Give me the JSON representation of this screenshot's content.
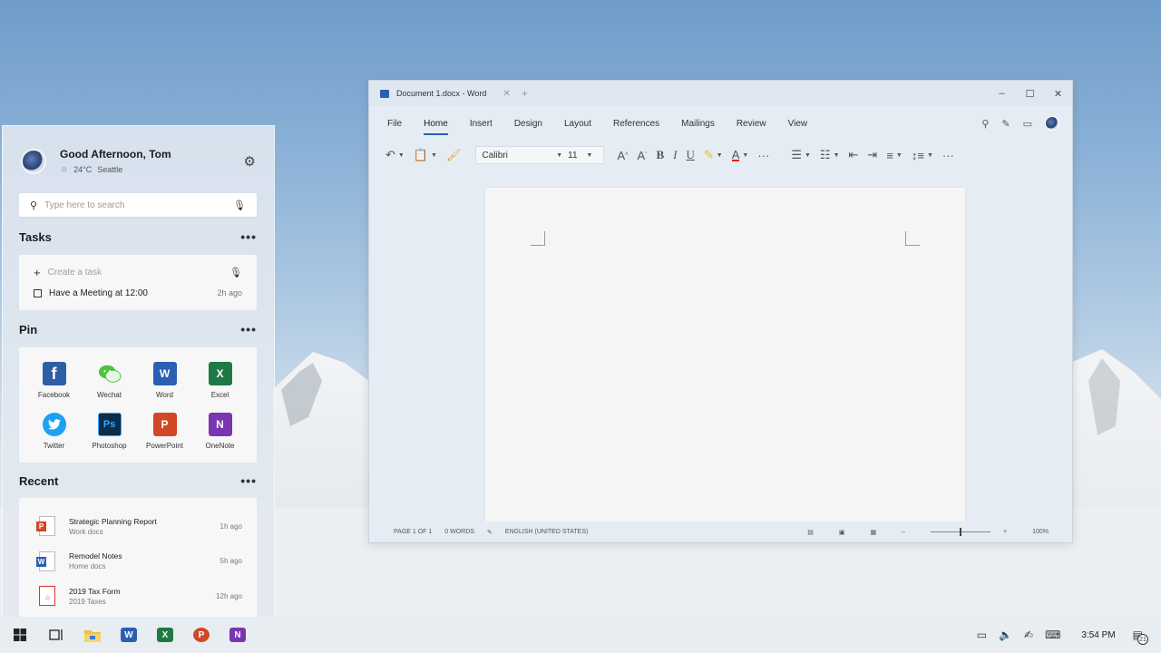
{
  "panel": {
    "greeting": "Good Afternoon, Tom",
    "temperature": "24°C",
    "city": "Seattle",
    "search_placeholder": "Type here to search",
    "tasks": {
      "title": "Tasks",
      "create_placeholder": "Create a task",
      "items": [
        {
          "text": "Have a Meeting at 12:00",
          "age": "2h ago"
        }
      ]
    },
    "pin": {
      "title": "Pin",
      "apps": [
        {
          "label": "Facebook"
        },
        {
          "label": "Wechat"
        },
        {
          "label": "Word"
        },
        {
          "label": "Excel"
        },
        {
          "label": "Twitter"
        },
        {
          "label": "Photoshop"
        },
        {
          "label": "PowerPoint"
        },
        {
          "label": "OneNote"
        }
      ]
    },
    "recent": {
      "title": "Recent",
      "items": [
        {
          "name": "Strategic Planning Report",
          "sub": "Work docs",
          "age": "1h ago"
        },
        {
          "name": "Remodel Notes",
          "sub": "Home docs",
          "age": "5h ago"
        },
        {
          "name": "2019 Tax Form",
          "sub": "2019 Taxes",
          "age": "12h ago"
        }
      ]
    }
  },
  "word": {
    "tab_title": "Document 1.docx - Word",
    "menu": [
      "File",
      "Home",
      "Insert",
      "Design",
      "Layout",
      "References",
      "Mailings",
      "Review",
      "View"
    ],
    "font_name": "Calibri",
    "font_size": "11",
    "status": {
      "page": "PAGE 1 OF 1",
      "words": "0 WORDS",
      "language": "ENGLISH (UNITED STATES)",
      "zoom": "100%"
    }
  },
  "taskbar": {
    "time": "3:54 PM",
    "notifications": "21"
  },
  "colors": {
    "word_blue": "#2b5fb4",
    "excel_green": "#1d7a45",
    "ppt_orange": "#d24726",
    "onenote_purple": "#7b35b0",
    "facebook_blue": "#2f5ea8",
    "wechat_green": "#4bc13e",
    "twitter_blue": "#1da1f2",
    "photoshop_dark": "#0c2c47"
  }
}
